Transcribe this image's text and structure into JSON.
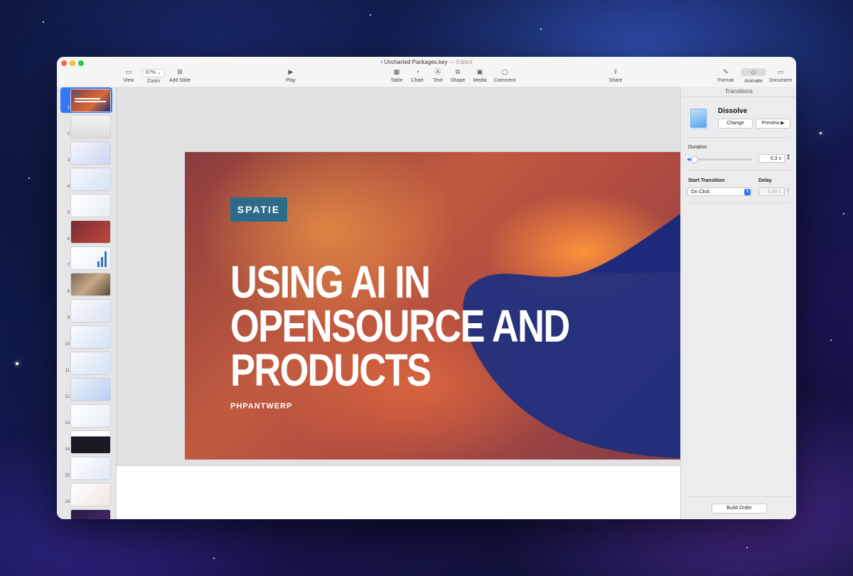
{
  "window": {
    "title": "Uncharted Packages.key",
    "status": "— Edited"
  },
  "toolbar": {
    "view": "View",
    "zoom_value": "67%",
    "zoom": "Zoom",
    "add_slide": "Add Slide",
    "play": "Play",
    "table": "Table",
    "chart": "Chart",
    "text": "Text",
    "shape": "Shape",
    "media": "Media",
    "comment": "Comment",
    "share": "Share",
    "format": "Format",
    "animate": "Animate",
    "document": "Document"
  },
  "slides": {
    "numbers": [
      "1",
      "2",
      "3",
      "4",
      "5",
      "6",
      "7",
      "8",
      "9",
      "10",
      "11",
      "12",
      "13",
      "14",
      "15",
      "16"
    ],
    "selected": 1
  },
  "slide": {
    "logo": "SPATIE",
    "title_line1": "USING AI IN",
    "title_line2": "OPENSOURCE AND PRODUCTS",
    "subtitle": "PHPANTWERP"
  },
  "inspector": {
    "header": "Transitions",
    "transition_name": "Dissolve",
    "change": "Change",
    "preview": "Preview ▶",
    "duration_label": "Duration",
    "duration_value": "0,3 s",
    "duration_fraction": 0.1,
    "start_transition_label": "Start Transition",
    "start_transition_value": "On Click",
    "delay_label": "Delay",
    "delay_value": "0,50 s",
    "build_order": "Build Order"
  },
  "colors": {
    "accent": "#3478f6",
    "logo_bg": "#2d6b8a",
    "traffic_red": "#fe5f57",
    "traffic_yellow": "#febc2e",
    "traffic_green": "#28c840"
  }
}
